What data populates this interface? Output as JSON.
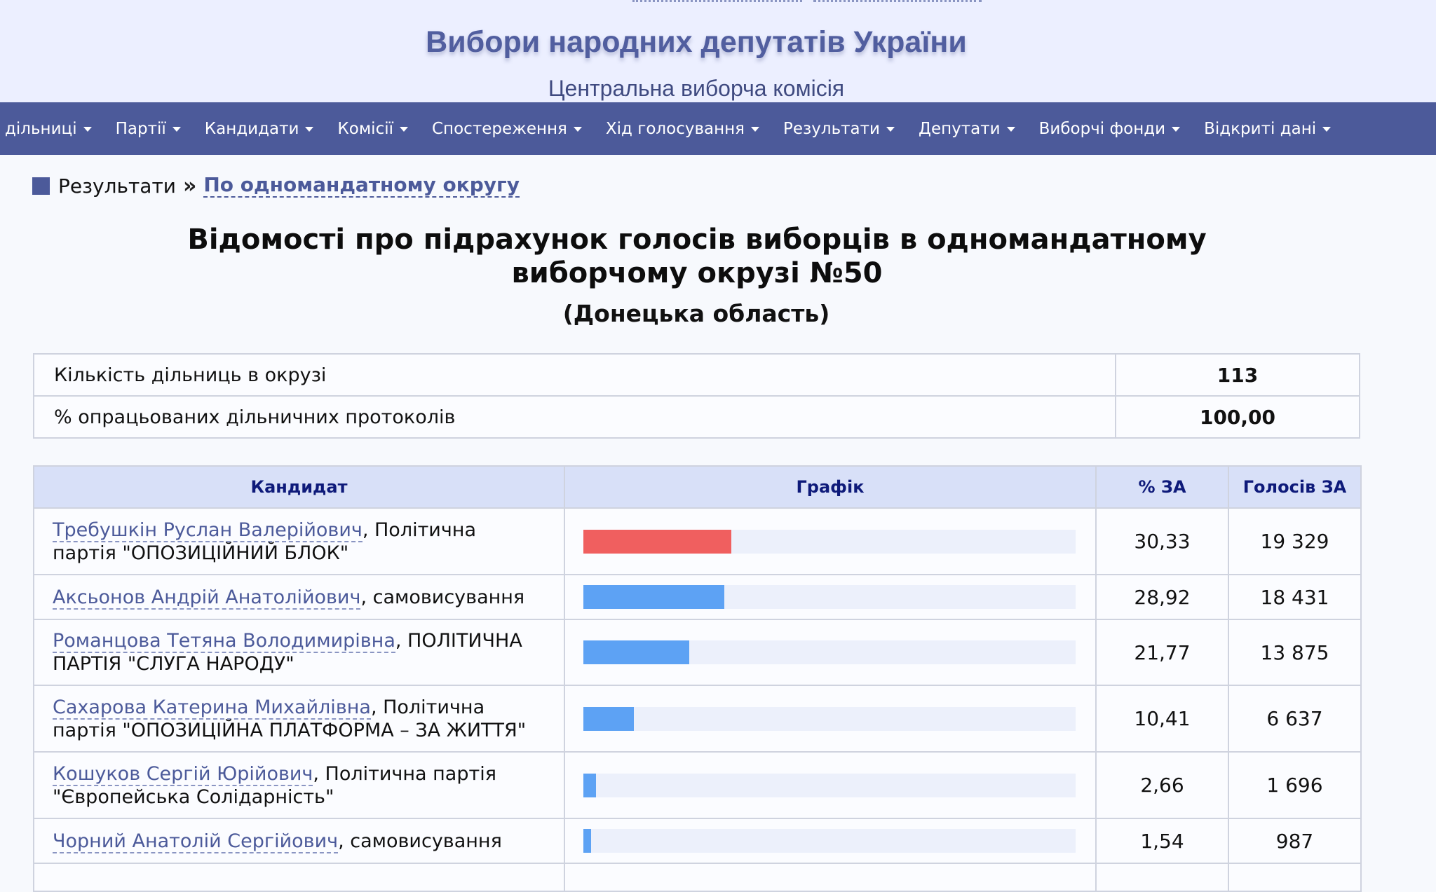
{
  "header": {
    "title": "Вибори народних депутатів України",
    "subtitle": "Центральна виборча комісія"
  },
  "nav": [
    {
      "label": "дільниці"
    },
    {
      "label": "Партії"
    },
    {
      "label": "Кандидати"
    },
    {
      "label": "Комісії"
    },
    {
      "label": "Спостереження"
    },
    {
      "label": "Хід голосування"
    },
    {
      "label": "Результати"
    },
    {
      "label": "Депутати"
    },
    {
      "label": "Виборчі фонди"
    },
    {
      "label": "Відкриті дані"
    }
  ],
  "breadcrumb": {
    "current": "Результати",
    "separator": "»",
    "link": "По одномандатному округу"
  },
  "page": {
    "title_line1": "Відомості про підрахунок голосів виборців в одномандатному",
    "title_line2": "виборчому окрузі №50",
    "region": "(Донецька область)"
  },
  "summary": [
    {
      "label": "Кількість дільниць в окрузі",
      "value": "113"
    },
    {
      "label": "% опрацьованих дільничних протоколів",
      "value": "100,00"
    }
  ],
  "results": {
    "headers": {
      "candidate": "Кандидат",
      "chart": "Графік",
      "percent": "% ЗА",
      "votes": "Голосів ЗА"
    },
    "colors": {
      "leader": "#f05f5f",
      "other": "#5da2f4"
    },
    "rows": [
      {
        "name": "Требушкін Руслан Валерійович",
        "affiliation": ", Політична партія \"ОПОЗИЦІЙНИЙ БЛОК\"",
        "percent": "30,33",
        "votes": "19 329",
        "pct_value": 30.33,
        "leader": true
      },
      {
        "name": "Аксьонов Андрій Анатолійович",
        "affiliation": ", самовисування",
        "percent": "28,92",
        "votes": "18 431",
        "pct_value": 28.92,
        "leader": false
      },
      {
        "name": "Романцова Тетяна Володимирівна",
        "affiliation": ", ПОЛІТИЧНА ПАРТІЯ \"СЛУГА НАРОДУ\"",
        "percent": "21,77",
        "votes": "13 875",
        "pct_value": 21.77,
        "leader": false
      },
      {
        "name": "Сахарова Катерина Михайлівна",
        "affiliation": ", Політична партія \"ОПОЗИЦІЙНА ПЛАТФОРМА – ЗА ЖИТТЯ\"",
        "percent": "10,41",
        "votes": "6 637",
        "pct_value": 10.41,
        "leader": false
      },
      {
        "name": "Кошуков Сергій Юрійович",
        "affiliation": ", Політична партія \"Європейська Солідарність\"",
        "percent": "2,66",
        "votes": "1 696",
        "pct_value": 2.66,
        "leader": false
      },
      {
        "name": "Чорний Анатолій Сергійович",
        "affiliation": ", самовисування",
        "percent": "1,54",
        "votes": "987",
        "pct_value": 1.54,
        "leader": false
      }
    ]
  }
}
